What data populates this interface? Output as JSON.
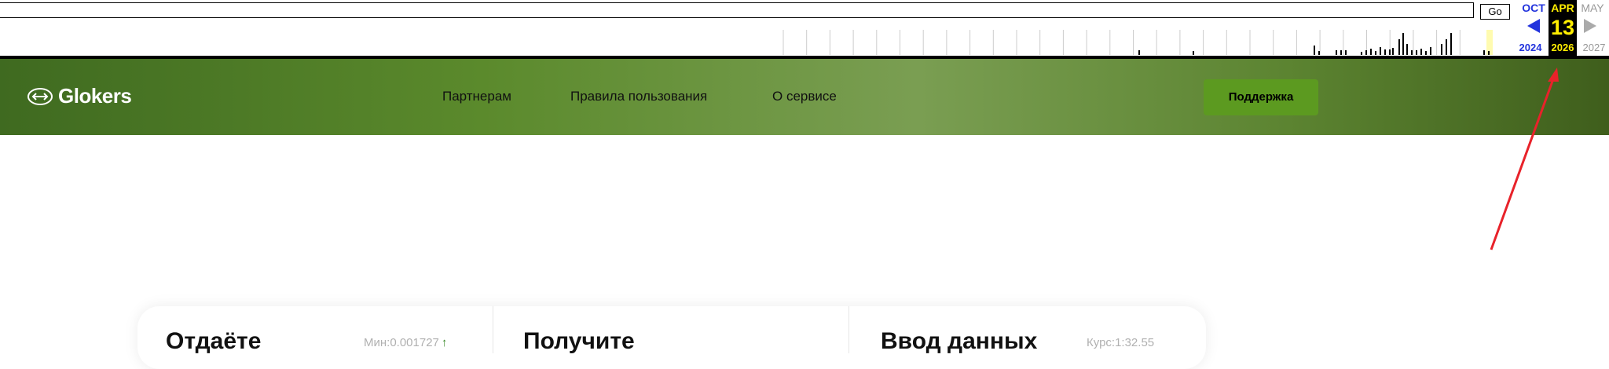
{
  "wayback": {
    "url_value": "",
    "go_label": "Go",
    "months": {
      "prev": "OCT",
      "current": "APR",
      "next": "MAY"
    },
    "day": "13",
    "years": {
      "prev": "2024",
      "current": "2026",
      "next": "2027"
    }
  },
  "header": {
    "logo": "Glokers",
    "nav": [
      "Партнерам",
      "Правила пользования",
      "О сервисе"
    ],
    "support_label": "Поддержка"
  },
  "exchange": {
    "pay": {
      "title": "Отдаёте",
      "min_text": "Мин:0.001727"
    },
    "receive": {
      "title": "Получите"
    },
    "data": {
      "title": "Ввод данных",
      "rate_text": "Курс:1:32.55"
    }
  },
  "colors": {
    "header_green": "#5b8a2c",
    "support_button": "#5c9a20",
    "wayback_highlight": "#ffee00",
    "annotation_arrow": "#e8222a"
  }
}
